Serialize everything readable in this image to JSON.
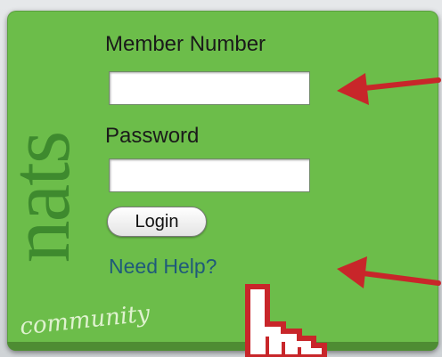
{
  "login_form": {
    "member_number_label": "Member Number",
    "member_number_value": "",
    "password_label": "Password",
    "password_value": "",
    "login_button_label": "Login",
    "help_link_label": "Need Help?"
  },
  "branding": {
    "wordmark": "nats",
    "tagline": "community"
  },
  "annotations": {
    "arrows": [
      "red-arrow-icon",
      "red-arrow-icon"
    ],
    "cursor": "hand-pointer-icon"
  },
  "colors": {
    "panel": "#6cbd4a",
    "wordmark": "#3e8a2e",
    "link": "#1f5a7a",
    "arrow": "#c8262a"
  }
}
